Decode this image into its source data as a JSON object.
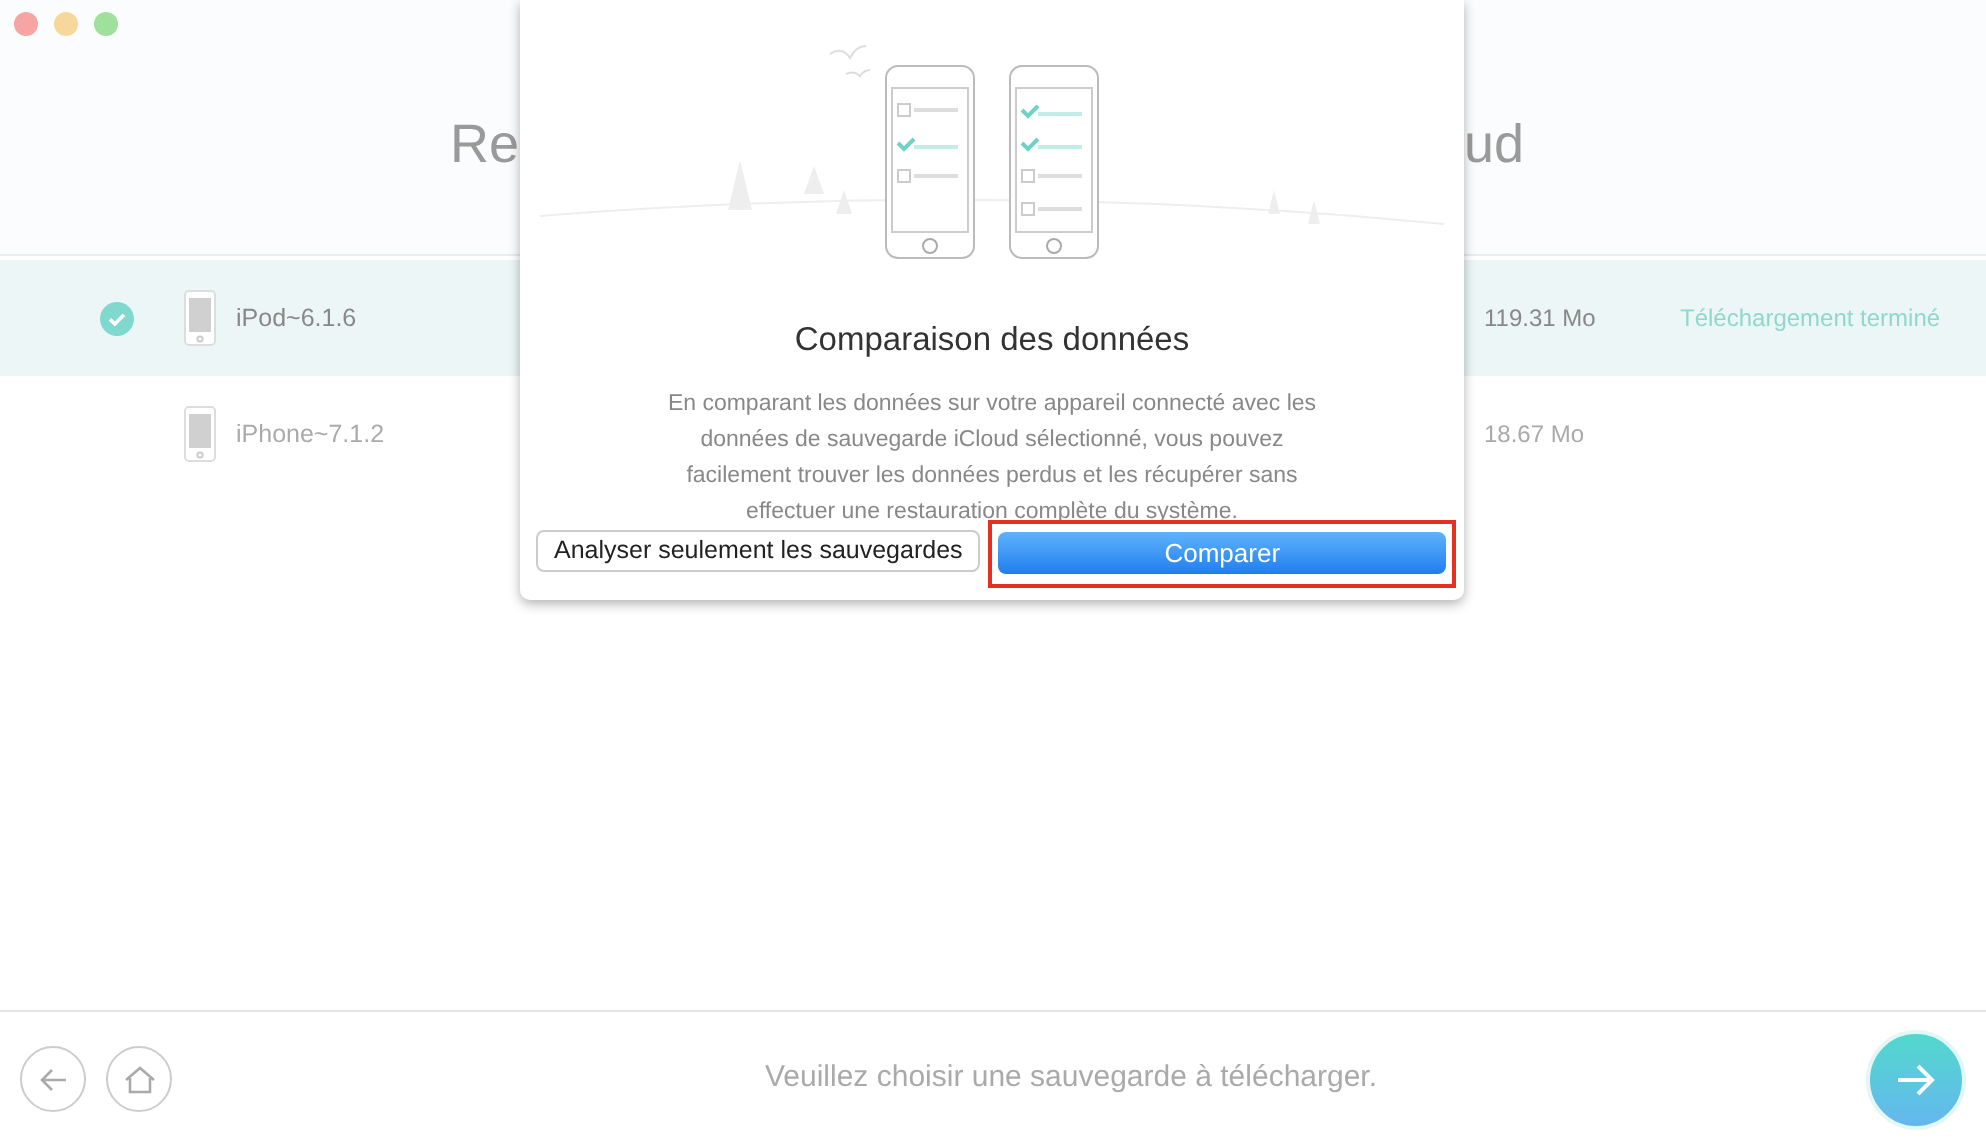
{
  "window": {
    "title_parts": [
      "Re",
      "ud"
    ]
  },
  "backups": [
    {
      "name": "iPod~6.1.6",
      "size": "119.31 Mo",
      "status": "Téléchargement terminé",
      "selected": true
    },
    {
      "name": "iPhone~7.1.2",
      "size": "18.67 Mo",
      "selected": false
    }
  ],
  "dialog": {
    "title": "Comparaison des données",
    "text": "En comparant les données sur votre appareil connecté avec les données de sauvegarde iCloud sélectionné, vous pouvez facilement trouver les données perdus et les récupérer sans effectuer une restauration complète du système.",
    "buttons": [
      {
        "label": "Analyser seulement les sauvegardes",
        "kind": "secondary",
        "highlighted": false
      },
      {
        "label": "Comparer",
        "kind": "primary",
        "highlighted": true
      }
    ]
  },
  "footer": {
    "message": "Veuillez choisir une sauvegarde à télécharger."
  }
}
